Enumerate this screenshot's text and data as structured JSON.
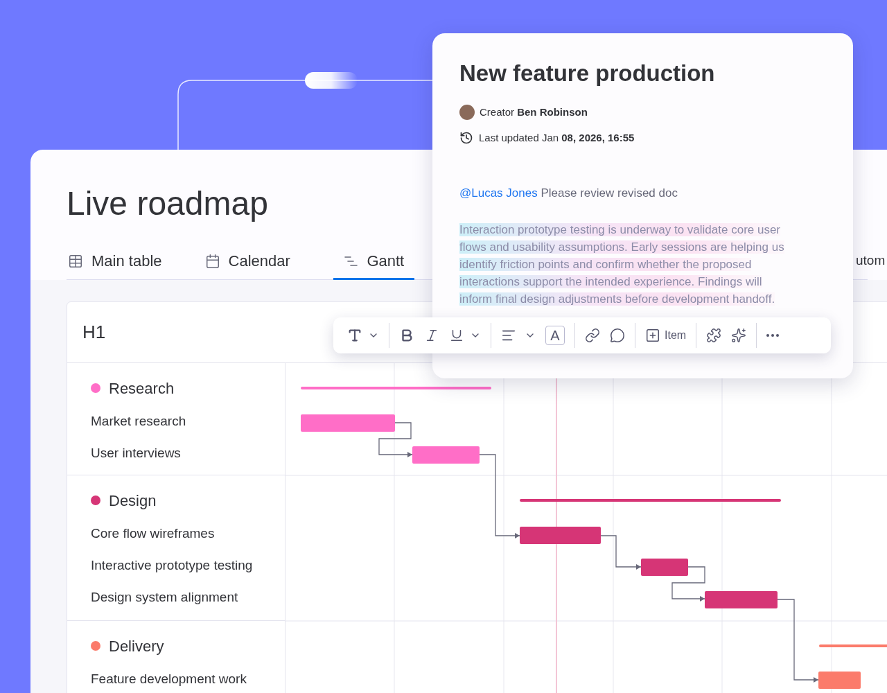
{
  "board": {
    "title": "Live roadmap",
    "tabs": [
      {
        "label": "Main table",
        "kind": "table",
        "selected": false
      },
      {
        "label": "Calendar",
        "kind": "calendar",
        "selected": false
      },
      {
        "label": "Gantt",
        "kind": "gantt",
        "selected": true
      },
      {
        "label": "utom",
        "kind": "partial",
        "selected": false
      }
    ],
    "header": "H1",
    "groups": [
      {
        "name": "Research",
        "color": "#ff6ec7",
        "tasks": [
          "Market research",
          "User interviews"
        ]
      },
      {
        "name": "Design",
        "color": "#d63576",
        "tasks": [
          "Core flow wireframes",
          "Interactive prototype testing",
          "Design system alignment"
        ]
      },
      {
        "name": "Delivery",
        "color": "#fb7b6b",
        "tasks": [
          "Feature development work"
        ]
      }
    ]
  },
  "doc": {
    "title": "New feature production",
    "creator": "Creator **Ben Robinson**",
    "updated": "Last updated Jan **08, 2026, 16:55**",
    "mention": "@Lucas Jones",
    "comment": "Please review revised doc",
    "paragraph": "Interaction prototype testing is underway to validate core user flows and usability assumptions. Early sessions are helping us identify friction points and confirm whether the proposed interactions support the intended experience. Findings will inform final design adjustments before development handoff."
  },
  "toolbar": {
    "text_color": "A",
    "item_button": "Item"
  }
}
